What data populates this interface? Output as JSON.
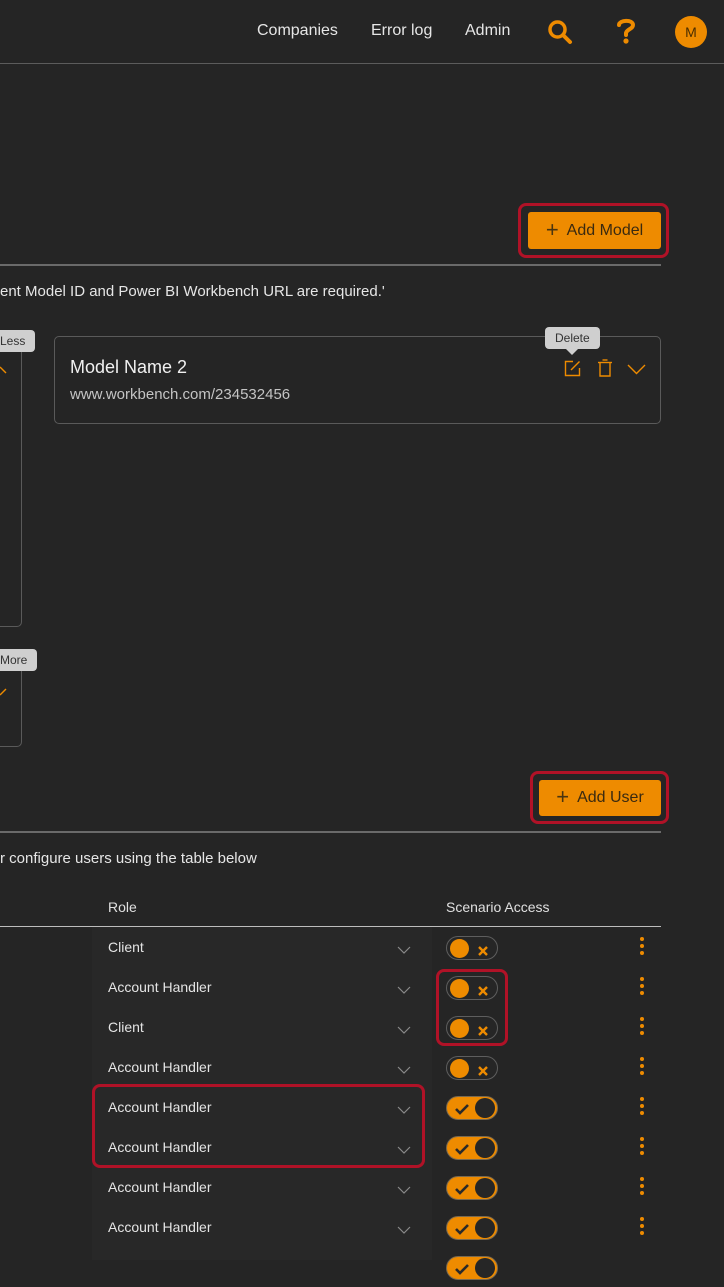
{
  "header": {
    "nav": [
      {
        "label": "Companies"
      },
      {
        "label": "Error log"
      },
      {
        "label": "Admin"
      }
    ],
    "search_icon": "search-icon",
    "help_icon": "help-icon",
    "avatar_initial": "M"
  },
  "models_section": {
    "add_button_label": "Add Model",
    "info_text": "ent Model ID and Power BI Workbench URL are required.'",
    "cards": [
      {
        "tooltip": "Less",
        "partial": true
      },
      {
        "title": "Model Name 2",
        "url": "www.workbench.com/234532456",
        "tooltip": "Delete"
      },
      {
        "tooltip": "More",
        "partial": true
      }
    ]
  },
  "users_section": {
    "add_button_label": "Add User",
    "info_text": "r configure users using the table below",
    "columns": {
      "role": "Role",
      "scenario_access": "Scenario Access"
    },
    "rows": [
      {
        "role": "Client",
        "scenario_access": false
      },
      {
        "role": "Account Handler",
        "scenario_access": false
      },
      {
        "role": "Client",
        "scenario_access": false
      },
      {
        "role": "Account Handler",
        "scenario_access": false
      },
      {
        "role": "Account Handler",
        "scenario_access": true
      },
      {
        "role": "Account Handler",
        "scenario_access": true
      },
      {
        "role": "Account Handler",
        "scenario_access": true
      },
      {
        "role": "Account Handler",
        "scenario_access": true
      },
      {
        "role": "",
        "scenario_access": true
      }
    ]
  },
  "colors": {
    "accent": "#ee8b00",
    "highlight": "#b01227",
    "background": "#252525"
  }
}
